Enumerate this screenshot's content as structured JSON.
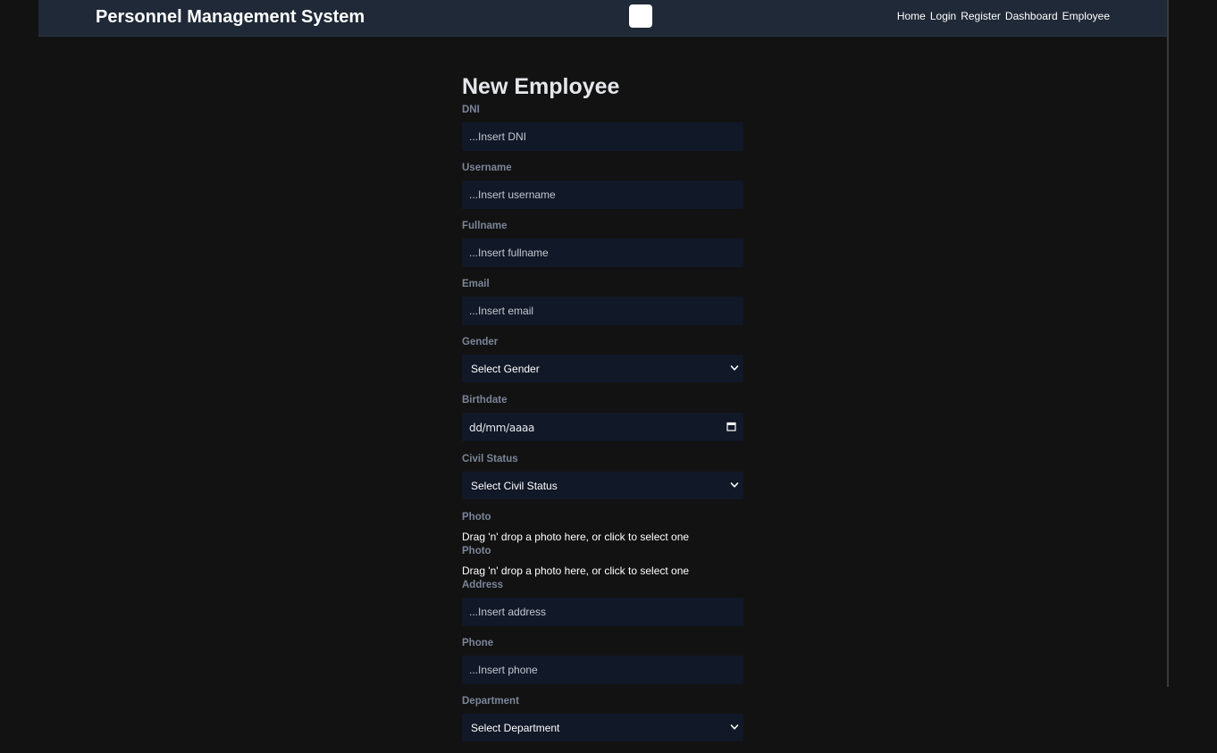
{
  "navbar": {
    "brand": "Personnel Management System",
    "links": [
      {
        "label": "Home"
      },
      {
        "label": "Login"
      },
      {
        "label": "Register"
      },
      {
        "label": "Dashboard"
      },
      {
        "label": "Employee"
      }
    ]
  },
  "form": {
    "title": "New Employee",
    "dni": {
      "label": "DNI",
      "placeholder": "...Insert DNI",
      "value": ""
    },
    "username": {
      "label": "Username",
      "placeholder": "...Insert username",
      "value": ""
    },
    "fullname": {
      "label": "Fullname",
      "placeholder": "...Insert fullname",
      "value": ""
    },
    "email": {
      "label": "Email",
      "placeholder": "...Insert email",
      "value": ""
    },
    "gender": {
      "label": "Gender",
      "selected": "Select Gender"
    },
    "birthdate": {
      "label": "Birthdate",
      "value": "dd/mm/aaaa"
    },
    "civil_status": {
      "label": "Civil Status",
      "selected": "Select Civil Status"
    },
    "photo_1": {
      "label": "Photo",
      "dropzone_text": "Drag 'n' drop a photo here, or click to select one"
    },
    "photo_2": {
      "label": "Photo",
      "dropzone_text": "Drag 'n' drop a photo here, or click to select one"
    },
    "address": {
      "label": "Address",
      "placeholder": "...Insert address",
      "value": ""
    },
    "phone": {
      "label": "Phone",
      "placeholder": "...Insert phone",
      "value": ""
    },
    "department": {
      "label": "Department",
      "selected": "Select Department"
    }
  },
  "colors": {
    "page_background": "#121212",
    "navbar_background": "#1f2937",
    "field_background": "#111827",
    "label_color": "#7a8599"
  },
  "icons": {
    "toggle": "theme-toggle-icon",
    "select_arrow": "chevron-down-icon",
    "date_picker": "calendar-icon"
  }
}
